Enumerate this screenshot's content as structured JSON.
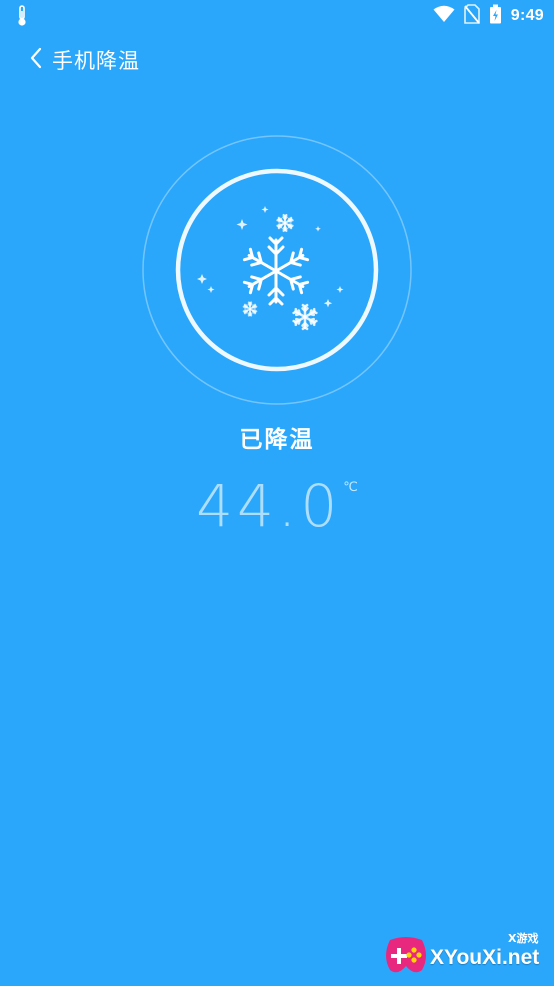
{
  "status_bar": {
    "time": "9:49",
    "left_icon": "thermometer-icon",
    "icons": [
      "wifi-icon",
      "no-sim-icon",
      "battery-icon"
    ]
  },
  "header": {
    "back_icon": "back-arrow-icon",
    "title": "手机降温"
  },
  "cooling": {
    "icon": "snowflake-icon",
    "state_label": "已降温",
    "temperature": "44.0",
    "unit": "℃"
  },
  "watermark": {
    "small_text": "X游戏",
    "main_text": "XYouXi.net"
  },
  "colors": {
    "background": "#2aa7fb",
    "text": "#ffffff",
    "temperature_text": "#e1f4ff"
  }
}
